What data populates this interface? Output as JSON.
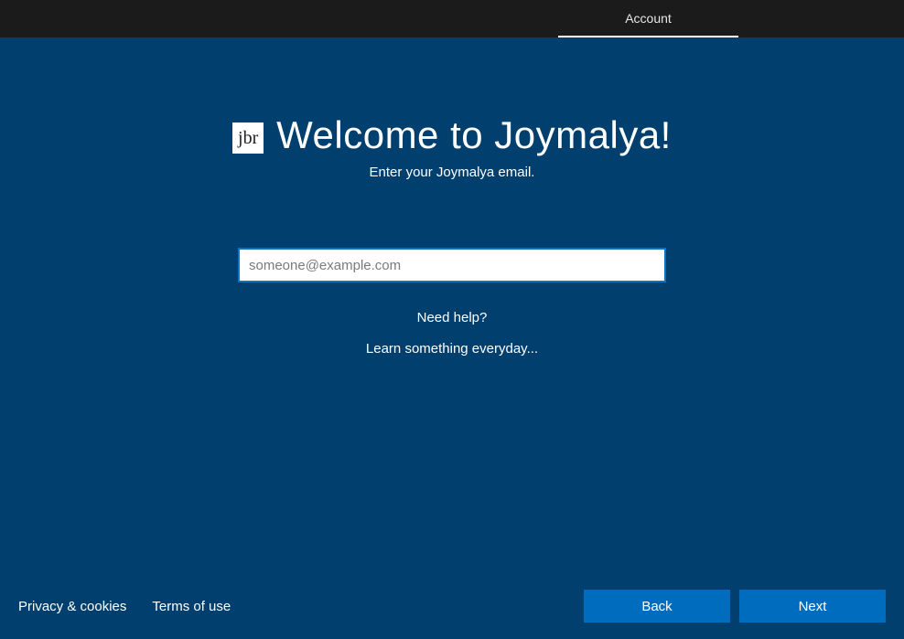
{
  "header": {
    "tab_label": "Account"
  },
  "main": {
    "logo_text": "jbr",
    "title": "Welcome to Joymalya!",
    "subtitle": "Enter your Joymalya email.",
    "email_placeholder": "someone@example.com",
    "help_link": "Need help?",
    "tagline": "Learn something everyday..."
  },
  "footer": {
    "privacy_label": "Privacy & cookies",
    "terms_label": "Terms of use",
    "back_label": "Back",
    "next_label": "Next"
  }
}
